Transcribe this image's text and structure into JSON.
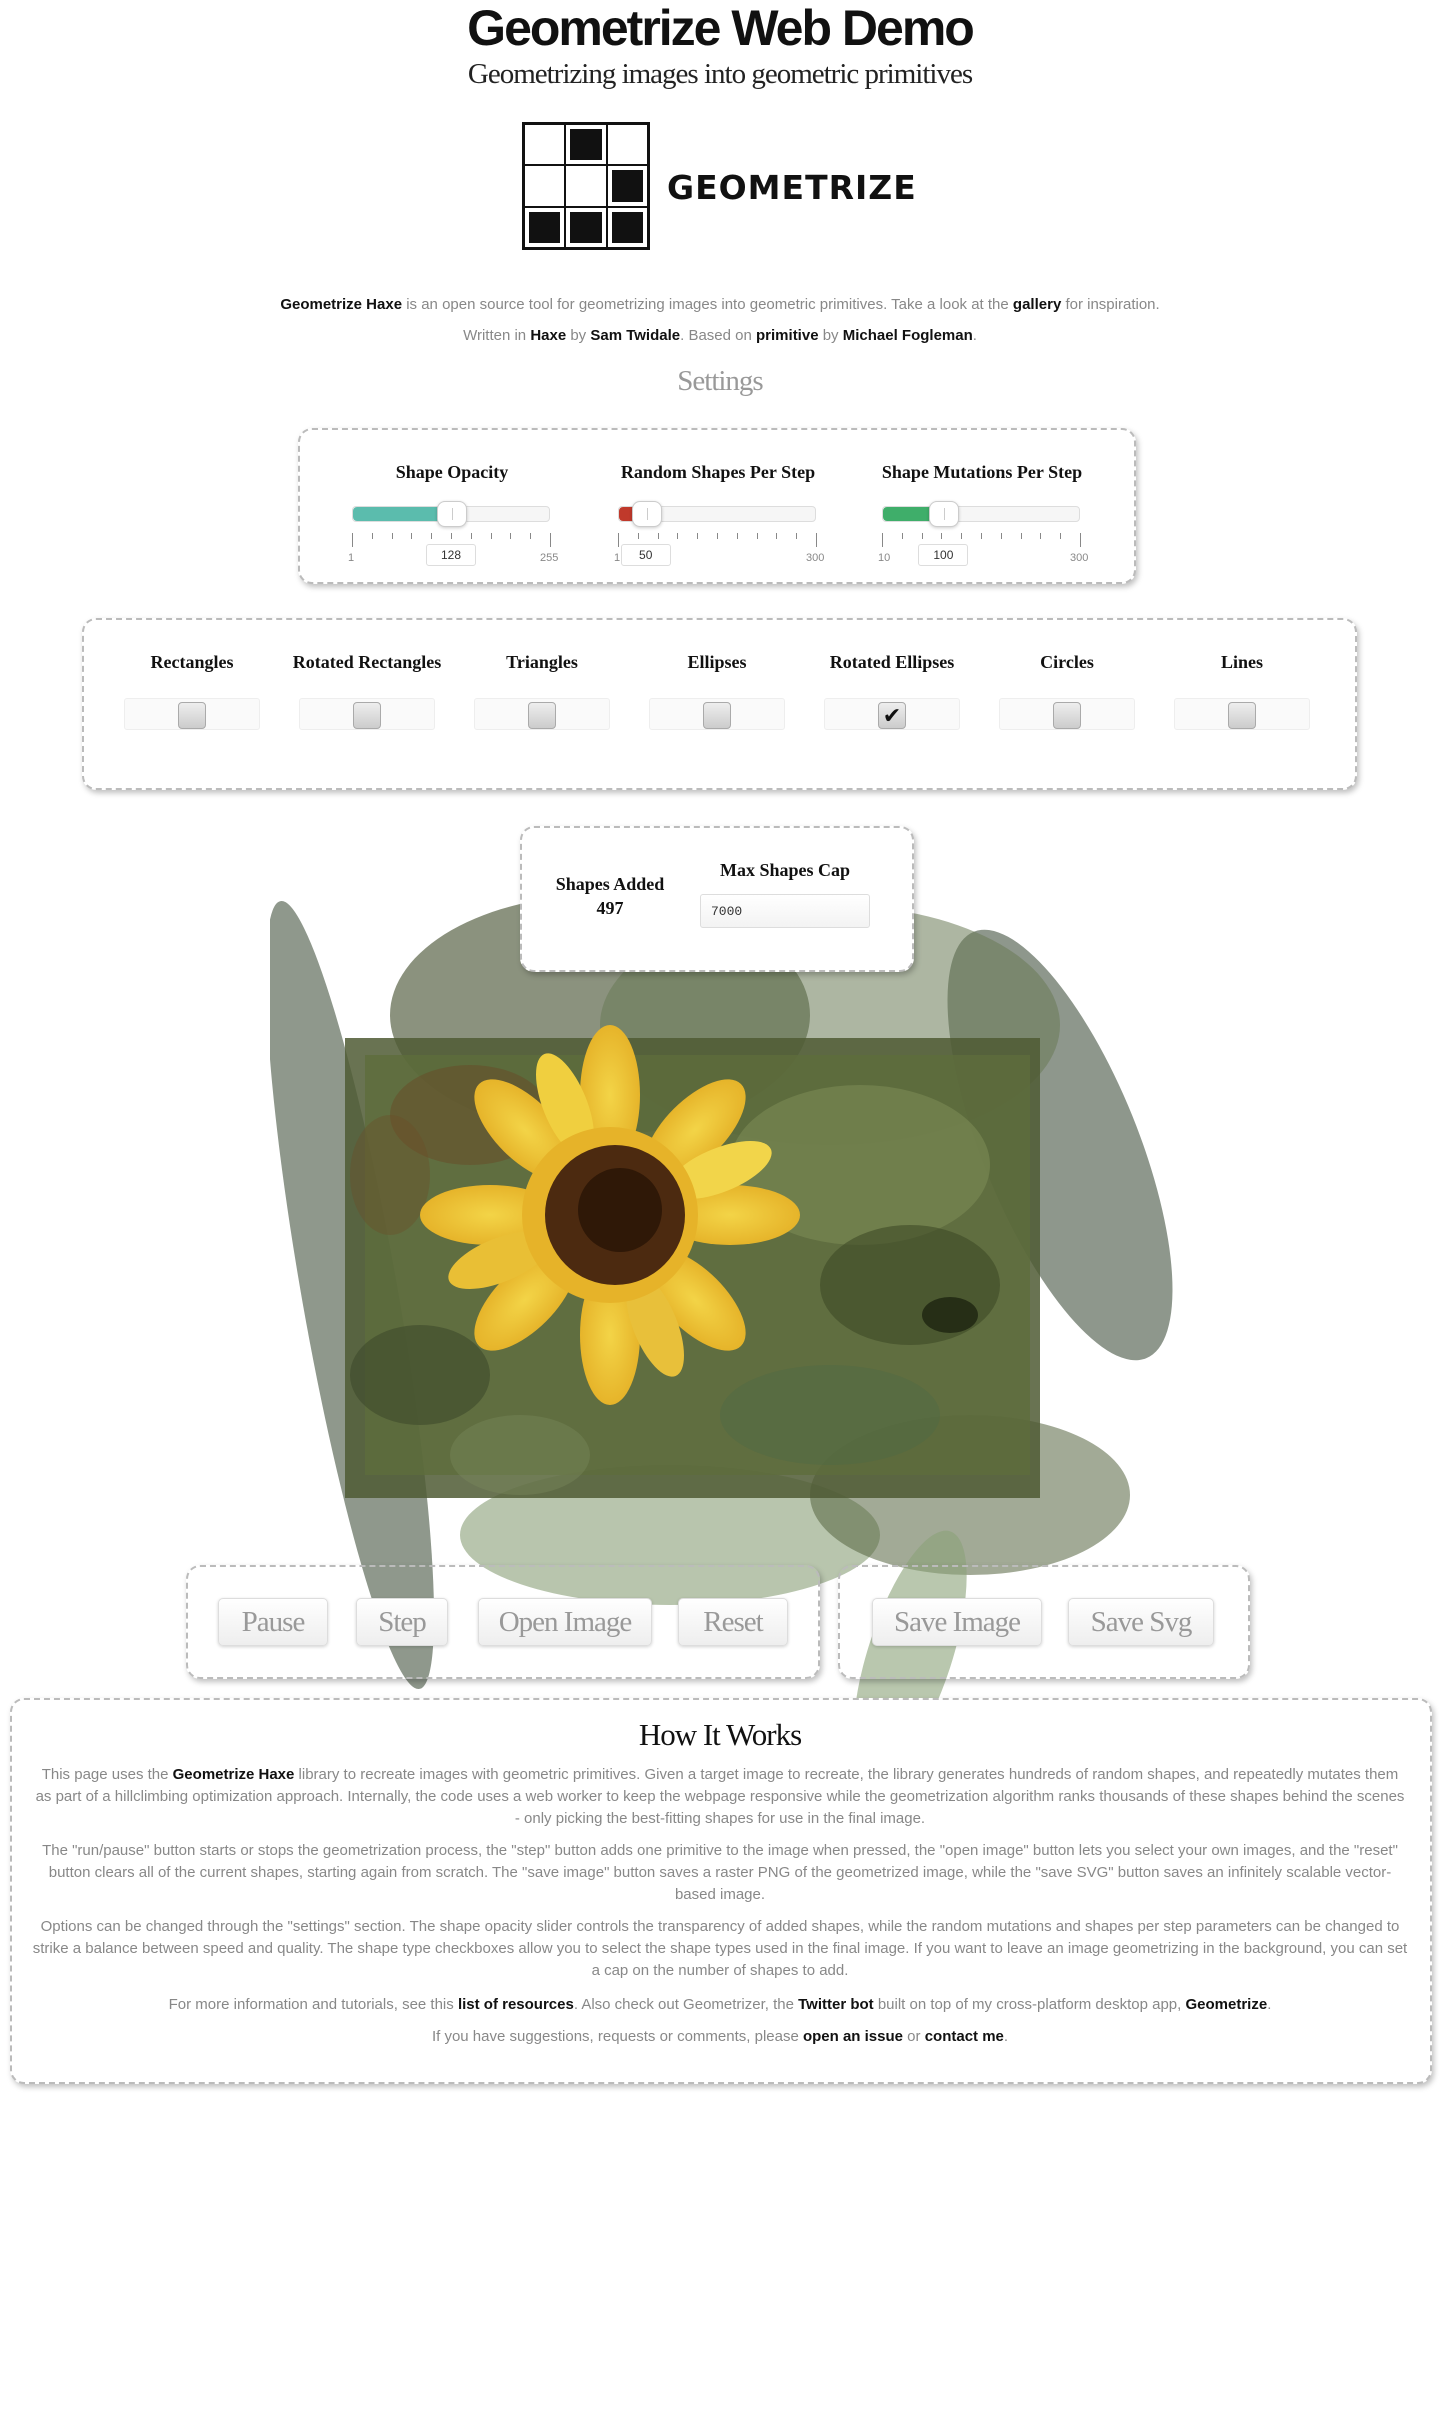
{
  "header": {
    "title": "Geometrize Web Demo",
    "subtitle": "Geometrizing images into geometric primitives",
    "logo_text": "GEOMETRIZE"
  },
  "intro": {
    "line1": {
      "project_link": "Geometrize Haxe",
      "text_a": " is an open source tool for geometrizing images into geometric primitives. Take a look at the ",
      "gallery_link": "gallery",
      "text_b": " for inspiration."
    },
    "line2": {
      "text_a": "Written in ",
      "haxe_link": "Haxe",
      "text_b": " by ",
      "author_link": "Sam Twidale",
      "text_c": ". Based on ",
      "primitive_link": "primitive",
      "text_d": " by ",
      "fogleman_link": "Michael Fogleman",
      "text_e": "."
    }
  },
  "settings": {
    "title": "Settings",
    "sliders": [
      {
        "label": "Shape Opacity",
        "min": "1",
        "max": "255",
        "value": "128",
        "fill_fraction": 0.5,
        "fill_color": "#5bbcad"
      },
      {
        "label": "Random Shapes Per Step",
        "min": "1",
        "max": "300",
        "value": "50",
        "fill_fraction": 0.14,
        "fill_color": "#c0392b"
      },
      {
        "label": "Shape Mutations Per Step",
        "min": "10",
        "max": "300",
        "value": "100",
        "fill_fraction": 0.31,
        "fill_color": "#3fae6a"
      }
    ],
    "shapes": [
      {
        "label": "Rectangles",
        "checked": false
      },
      {
        "label": "Rotated Rectangles",
        "checked": false
      },
      {
        "label": "Triangles",
        "checked": false
      },
      {
        "label": "Ellipses",
        "checked": false
      },
      {
        "label": "Rotated Ellipses",
        "checked": true
      },
      {
        "label": "Circles",
        "checked": false
      },
      {
        "label": "Lines",
        "checked": false
      }
    ],
    "check_mark": "✔"
  },
  "counter": {
    "shapes_added_label": "Shapes Added",
    "shapes_added_value": "497",
    "max_cap_label": "Max Shapes Cap",
    "max_cap_value": "7000"
  },
  "buttons": {
    "pause": "Pause",
    "step": "Step",
    "open_image": "Open Image",
    "reset": "Reset",
    "save_image": "Save Image",
    "save_svg": "Save Svg"
  },
  "how_it_works": {
    "title": "How It Works",
    "p1": {
      "a": "This page uses the ",
      "link": "Geometrize Haxe",
      "b": " library to recreate images with geometric primitives. Given a target image to recreate, the library generates hundreds of random shapes, and repeatedly mutates them as part of a hillclimbing optimization approach. Internally, the code uses a web worker to keep the webpage responsive while the geometrization algorithm ranks thousands of these shapes behind the scenes - only picking the best-fitting shapes for use in the final image."
    },
    "p2": "The \"run/pause\" button starts or stops the geometrization process, the \"step\" button adds one primitive to the image when pressed, the \"open image\" button lets you select your own images, and the \"reset\" button clears all of the current shapes, starting again from scratch. The \"save image\" button saves a raster PNG of the geometrized image, while the \"save SVG\" button saves an infinitely scalable vector-based image.",
    "p3": "Options can be changed through the \"settings\" section. The shape opacity slider controls the transparency of added shapes, while the random mutations and shapes per step parameters can be changed to strike a balance between speed and quality. The shape type checkboxes allow you to select the shape types used in the final image. If you want to leave an image geometrizing in the background, you can set a cap on the number of shapes to add.",
    "p4": {
      "a": "For more information and tutorials, see this ",
      "resources_link": "list of resources",
      "b": ". Also check out Geometrizer, the ",
      "twitter_link": "Twitter bot",
      "c": " built on top of my cross-platform desktop app, ",
      "app_link": "Geometrize",
      "d": "."
    },
    "p5": {
      "a": "If you have suggestions, requests or comments, please ",
      "issue_link": "open an issue",
      "b": " or ",
      "contact_link": "contact me",
      "c": "."
    }
  }
}
